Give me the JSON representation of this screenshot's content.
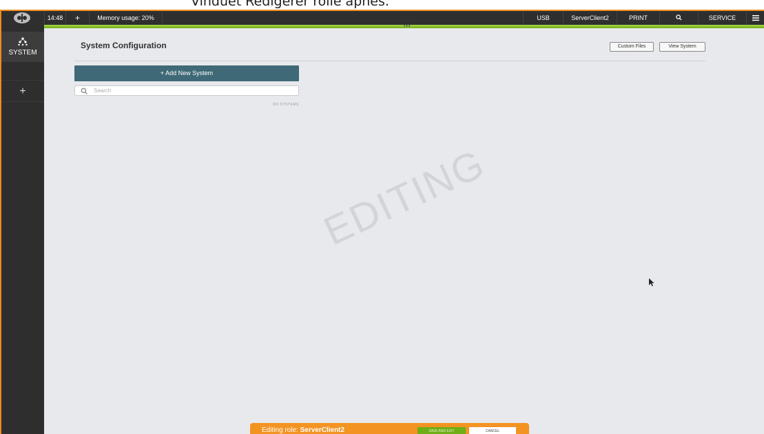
{
  "caption": "Vinduet Redigerer rolle åpnes.",
  "topbar": {
    "time": "14:48",
    "add_label": "+",
    "memory": "Memory usage: 20%",
    "items": [
      "USB",
      "ServerClient2",
      "PRINT",
      "SERVICE"
    ],
    "menu_icon": "hamburger-icon"
  },
  "sidebar": {
    "system_label": "SYSTEM",
    "add_label": "+"
  },
  "main": {
    "title": "System Configuration",
    "buttons": {
      "custom_files": "Custom Files",
      "view_system": "View System"
    },
    "add_system": "+ Add New System",
    "search_placeholder": "Search",
    "systems_count": "0/0 SYSTEMS",
    "watermark": "EDITING"
  },
  "editbar": {
    "prefix": "Editing role:",
    "role_name": "ServerClient2",
    "save_label": "SAVE AND EXIT",
    "cancel_label": "CANCEL"
  },
  "colors": {
    "accent_orange": "#ef8a1e",
    "green_bar": "#6fae17",
    "add_button": "#3f6977",
    "topbar": "#2f2f2f"
  }
}
